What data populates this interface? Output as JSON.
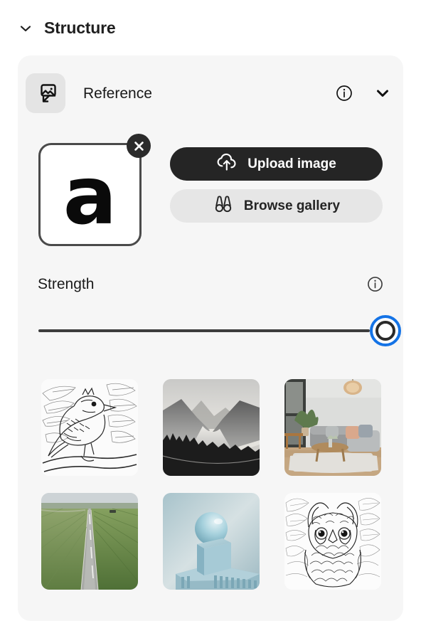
{
  "section": {
    "title": "Structure",
    "collapse_icon": "chevron-down-icon"
  },
  "reference": {
    "label": "Reference",
    "icon": "image-reference-icon",
    "info_icon": "info-icon",
    "chevron_icon": "chevron-down-icon"
  },
  "upload": {
    "thumbnail_glyph": "a",
    "thumbnail_alt": "reference-image-letter-a",
    "remove_icon": "close-icon",
    "upload_label": "Upload image",
    "upload_icon": "cloud-upload-icon",
    "browse_label": "Browse gallery",
    "browse_icon": "binoculars-icon"
  },
  "strength": {
    "label": "Strength",
    "info_icon": "info-icon",
    "value_percent": 100,
    "min": 0,
    "max": 100,
    "focus_color": "#1473e6",
    "track_color": "#3d3d3d"
  },
  "gallery": {
    "items": [
      {
        "name": "bird-line-art",
        "alt": "Line art drawing of a blue jay on a branch with leaves"
      },
      {
        "name": "misty-mountains",
        "alt": "Grayscale misty mountain lake landscape"
      },
      {
        "name": "living-room-interior",
        "alt": "Modern living room with gray sofa and pendant light"
      },
      {
        "name": "aerial-road-fields",
        "alt": "Aerial view of a straight road through green fields"
      },
      {
        "name": "geometric-sphere-cube",
        "alt": "Blue 3D sphere floating above a cube"
      },
      {
        "name": "owl-line-art",
        "alt": "Detailed line art drawing of an owl"
      }
    ]
  },
  "colors": {
    "page_background": "#ffffff",
    "card_background": "#f6f6f6",
    "primary_button": "#252525",
    "secondary_button": "#e6e6e6",
    "text": "#1f1f1f"
  }
}
